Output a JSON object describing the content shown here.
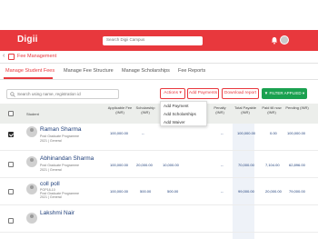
{
  "header": {
    "logo": "Digii",
    "search_placeholder": "Search Digii Campus"
  },
  "breadcrumb": {
    "title": "Fee Management"
  },
  "tabs": [
    {
      "label": "Manage Student Fees",
      "active": true
    },
    {
      "label": "Manage Fee Structure",
      "active": false
    },
    {
      "label": "Manage Scholarships",
      "active": false
    },
    {
      "label": "Fee Reports",
      "active": false
    }
  ],
  "toolbar": {
    "search_placeholder": "Search using name, registration id",
    "actions_label": "Actions ▾",
    "add_payments_label": "Add Payments",
    "download_report_label": "Download report",
    "filter_label": "▼ FILTER APPLIED ▾"
  },
  "actions_menu": [
    "Add Payment",
    "Add Scholarships",
    "Add Waiver"
  ],
  "table": {
    "columns": [
      "Student",
      "Applicable Fee (INR)",
      "Scholarship (INR)",
      "Penalty (INR)",
      "Total Payable (INR)",
      "Paid till now (INR)",
      "Pending (INR)"
    ],
    "rows": [
      {
        "name": "Raman Sharma",
        "program": "Post Graduate Programme",
        "batch": "2021 | General",
        "applicable_fee": "100,000.00",
        "scholarship": "--",
        "penalty": "--",
        "total_payable": "100,000.00",
        "paid_till_now": "0.00",
        "pending": "100,000.00",
        "selected": true
      },
      {
        "name": "Abhinandan Sharma",
        "program": "Post Graduate Programme",
        "batch": "2021 | General",
        "applicable_fee": "100,000.00",
        "scholarship": "20,000.00",
        "discount": "10,000.00",
        "penalty": "--",
        "total_payable": "70,000.00",
        "paid_till_now": "7,104.00",
        "pending": "62,896.00",
        "selected": false
      },
      {
        "name": "coll poll",
        "id": "POP18-10",
        "program": "Post Graduate Programme",
        "batch": "2021 | General",
        "applicable_fee": "100,000.00",
        "scholarship": "500.00",
        "discount": "500.00",
        "penalty": "--",
        "total_payable": "99,000.00",
        "paid_till_now": "20,000.00",
        "pending": "79,000.00",
        "selected": false
      },
      {
        "name": "Lakshmi Nair"
      }
    ]
  },
  "colors": {
    "brand": "#e8383d",
    "filter_green": "#1aa150",
    "link_blue": "#1f3f7a"
  }
}
